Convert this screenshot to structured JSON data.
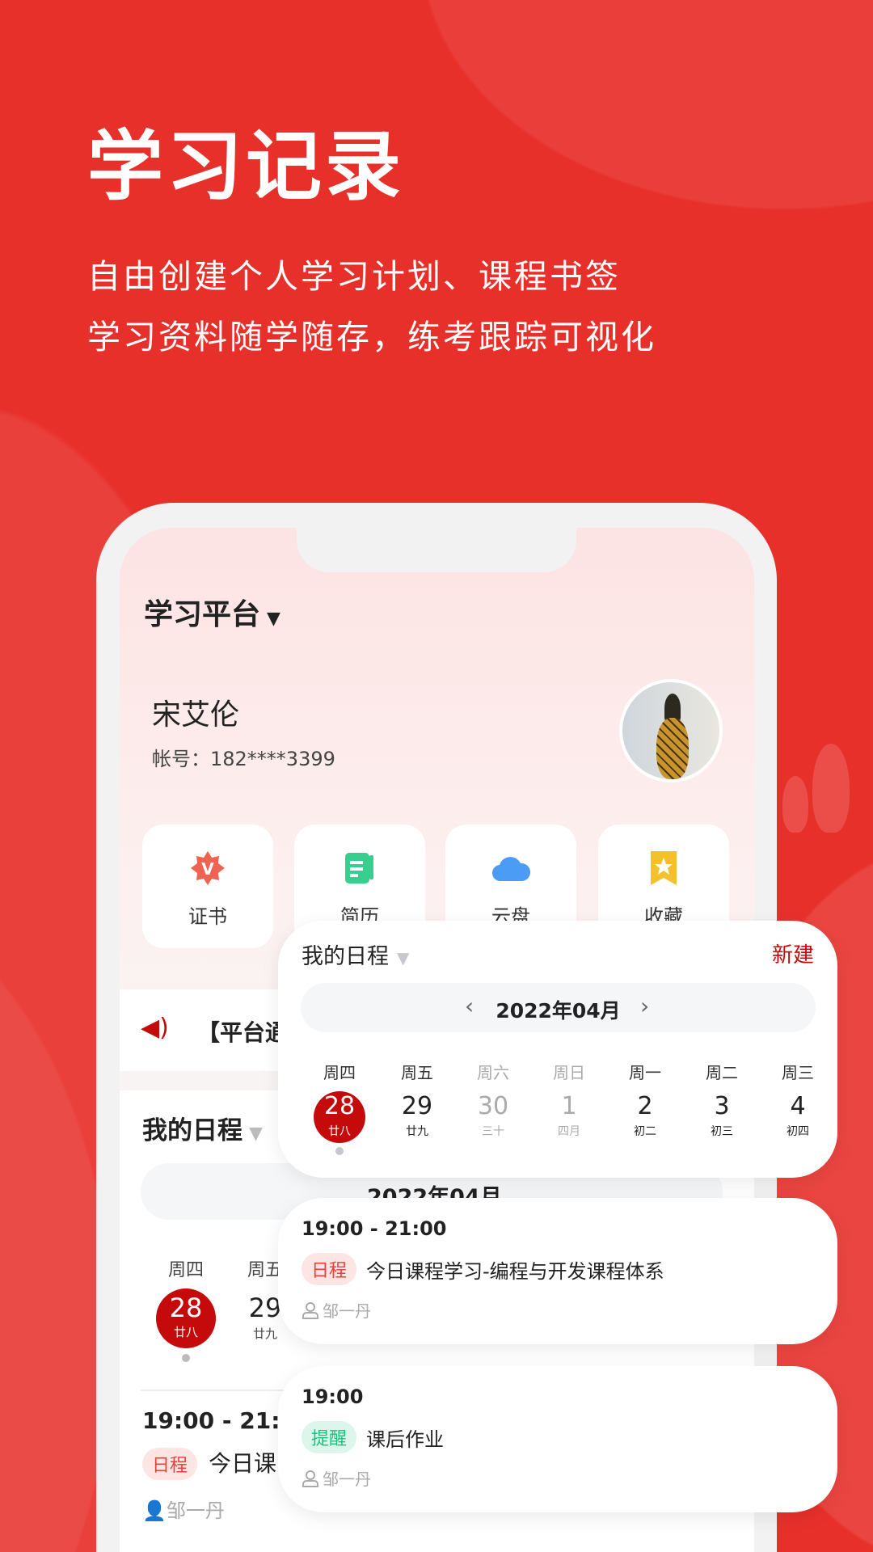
{
  "hero": {
    "title": "学习记录",
    "subtitle_lines": [
      "自由创建个人学习计划、课程书签",
      "学习资料随学随存，练考跟踪可视化"
    ]
  },
  "app": {
    "platform_label": "学习平台",
    "user": {
      "name": "宋艾伦",
      "account": "帐号：182****3399"
    },
    "tiles": [
      {
        "label": "证书",
        "icon": "certificate-badge-icon"
      },
      {
        "label": "简历",
        "icon": "resume-document-icon"
      },
      {
        "label": "云盘",
        "icon": "cloud-icon"
      },
      {
        "label": "收藏",
        "icon": "bookmark-star-icon"
      }
    ],
    "notice": "【平台通",
    "schedule_bg": {
      "title": "我的日程",
      "month": "2022年04月",
      "weekday": "周四",
      "weekday2": "周五",
      "day": "28",
      "lunar": "廿八",
      "day2": "29",
      "lunar2": "廿九",
      "event_time": "19:00 - 21:00",
      "event_tag": "日程",
      "event_title": "今日课",
      "person": "邹一丹"
    }
  },
  "schedule": {
    "title": "我的日程",
    "new_label": "新建",
    "month": "2022年04月",
    "days": [
      {
        "weekday": "周四",
        "day": "28",
        "lunar": "廿八",
        "selected": true,
        "muted": false
      },
      {
        "weekday": "周五",
        "day": "29",
        "lunar": "廿九",
        "muted": false
      },
      {
        "weekday": "周六",
        "day": "30",
        "lunar": "三十",
        "muted": true
      },
      {
        "weekday": "周日",
        "day": "1",
        "lunar": "四月",
        "muted": true
      },
      {
        "weekday": "周一",
        "day": "2",
        "lunar": "初二",
        "muted": false
      },
      {
        "weekday": "周二",
        "day": "3",
        "lunar": "初三",
        "muted": false
      },
      {
        "weekday": "周三",
        "day": "4",
        "lunar": "初四",
        "muted": false
      }
    ],
    "events": [
      {
        "time": "19:00 - 21:00",
        "tag": "日程",
        "tag_color": "#e8403a",
        "tag_bg": "#fde5e4",
        "title": "今日课程学习-编程与开发课程体系",
        "person": "邹一丹"
      },
      {
        "time": "19:00",
        "tag": "提醒",
        "tag_color": "#1fbf7d",
        "tag_bg": "#ddf6ec",
        "title": "课后作业",
        "person": "邹一丹"
      }
    ]
  },
  "colors": {
    "brand_red": "#e8302b",
    "accent": "#c40a0a"
  }
}
